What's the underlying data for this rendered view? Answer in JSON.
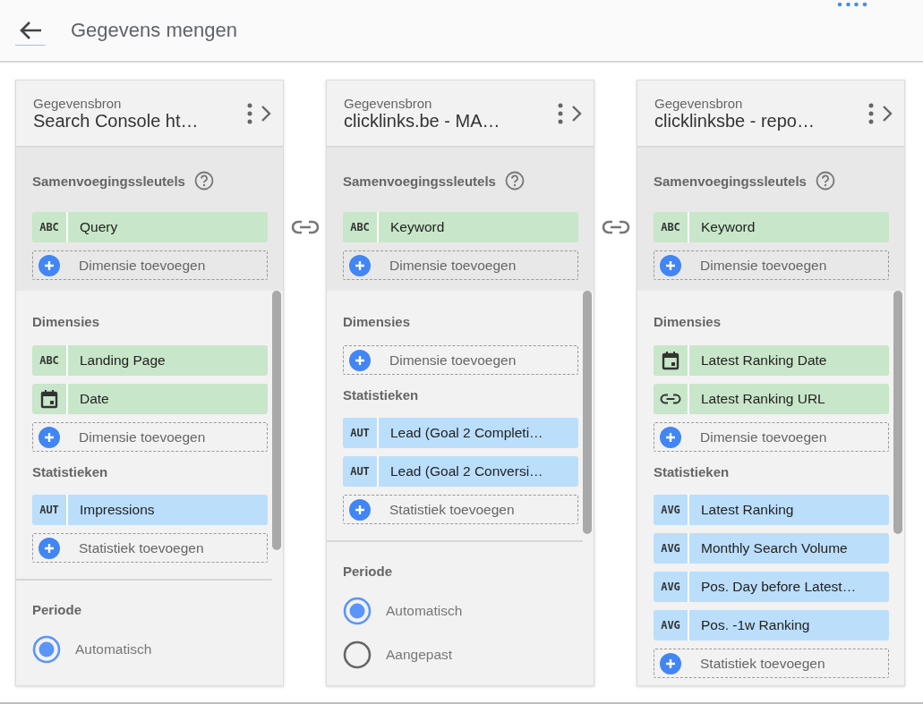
{
  "header": {
    "title": "Gegevens mengen"
  },
  "sources": [
    {
      "label": "Gegevensbron",
      "name": "Search Console ht…",
      "join_keys": {
        "heading": "Samenvoegingssleutels",
        "items": [
          {
            "kind": "label",
            "badge": "ABC",
            "name": "Query"
          }
        ],
        "add": "Dimensie toevoegen"
      },
      "dimensions": {
        "heading": "Dimensies",
        "items": [
          {
            "kind": "label",
            "badge": "ABC",
            "name": "Landing Page"
          },
          {
            "kind": "date",
            "name": "Date"
          }
        ],
        "add": "Dimensie toevoegen"
      },
      "metrics": {
        "heading": "Statistieken",
        "items": [
          {
            "kind": "label",
            "badge": "AUT",
            "name": "Impressions"
          }
        ],
        "add": "Statistiek toevoegen"
      },
      "period": {
        "heading": "Periode",
        "options": [
          {
            "label": "Automatisch",
            "selected": true
          }
        ]
      }
    },
    {
      "label": "Gegevensbron",
      "name": "clicklinks.be - MA…",
      "join_keys": {
        "heading": "Samenvoegingssleutels",
        "items": [
          {
            "kind": "label",
            "badge": "ABC",
            "name": "Keyword"
          }
        ],
        "add": "Dimensie toevoegen"
      },
      "dimensions": {
        "heading": "Dimensies",
        "add": "Dimensie toevoegen"
      },
      "metrics": {
        "heading": "Statistieken",
        "items": [
          {
            "kind": "label",
            "badge": "AUT",
            "name": "Lead (Goal 2 Completi…"
          },
          {
            "kind": "label",
            "badge": "AUT",
            "name": "Lead (Goal 2 Conversi…"
          }
        ],
        "add": "Statistiek toevoegen"
      },
      "period": {
        "heading": "Periode",
        "options": [
          {
            "label": "Automatisch",
            "selected": true
          },
          {
            "label": "Aangepast",
            "selected": false
          }
        ]
      }
    },
    {
      "label": "Gegevensbron",
      "name": "clicklinksbe - repo…",
      "join_keys": {
        "heading": "Samenvoegingssleutels",
        "items": [
          {
            "kind": "label",
            "badge": "ABC",
            "name": "Keyword"
          }
        ],
        "add": "Dimensie toevoegen"
      },
      "dimensions": {
        "heading": "Dimensies",
        "items": [
          {
            "kind": "date",
            "name": "Latest Ranking Date"
          },
          {
            "kind": "url",
            "name": "Latest Ranking URL"
          }
        ],
        "add": "Dimensie toevoegen"
      },
      "metrics": {
        "heading": "Statistieken",
        "items": [
          {
            "kind": "label",
            "badge": "AVG",
            "name": "Latest Ranking"
          },
          {
            "kind": "label",
            "badge": "AVG",
            "name": "Monthly Search Volume"
          },
          {
            "kind": "label",
            "badge": "AVG",
            "name": "Pos. Day before Latest…"
          },
          {
            "kind": "label",
            "badge": "AVG",
            "name": "Pos. -1w Ranking"
          }
        ],
        "add": "Statistiek toevoegen"
      }
    }
  ]
}
